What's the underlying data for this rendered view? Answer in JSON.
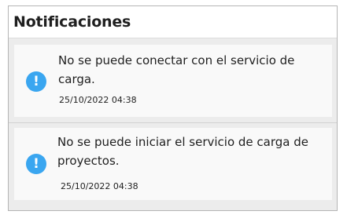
{
  "panel": {
    "title": "Notificaciones"
  },
  "notifications": [
    {
      "icon": "info-alert-icon",
      "message": "No se puede conectar con el servicio de carga.",
      "timestamp": "25/10/2022 04:38"
    },
    {
      "icon": "info-alert-icon",
      "message": "No se puede iniciar el servicio de carga de proyectos.",
      "timestamp": "25/10/2022 04:38"
    }
  ],
  "colors": {
    "icon_blue": "#3aa6f0",
    "card_background": "#f9f9f9",
    "panel_background": "#ececec",
    "border": "#b5b5b5"
  }
}
